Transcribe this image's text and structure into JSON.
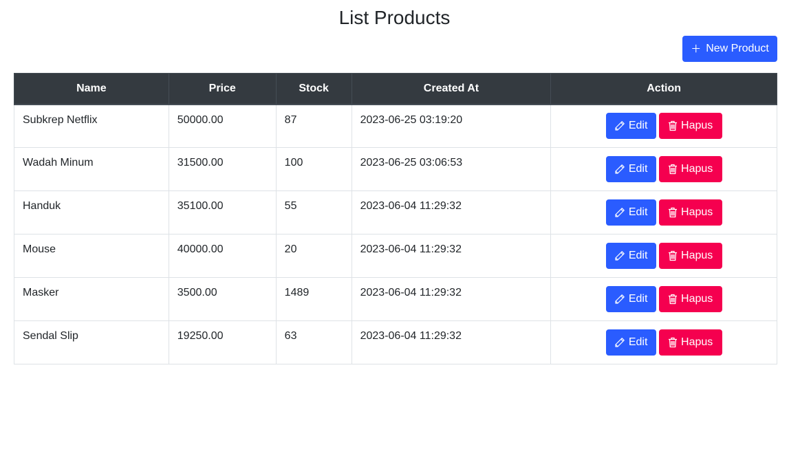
{
  "page": {
    "title": "List Products",
    "new_button_label": "New Product"
  },
  "table": {
    "headers": [
      "Name",
      "Price",
      "Stock",
      "Created At",
      "Action"
    ],
    "rows": [
      {
        "name": "Subkrep Netflix",
        "price": "50000.00",
        "stock": "87",
        "created_at": "2023-06-25 03:19:20"
      },
      {
        "name": "Wadah Minum",
        "price": "31500.00",
        "stock": "100",
        "created_at": "2023-06-25 03:06:53"
      },
      {
        "name": "Handuk",
        "price": "35100.00",
        "stock": "55",
        "created_at": "2023-06-04 11:29:32"
      },
      {
        "name": "Mouse",
        "price": "40000.00",
        "stock": "20",
        "created_at": "2023-06-04 11:29:32"
      },
      {
        "name": "Masker",
        "price": "3500.00",
        "stock": "1489",
        "created_at": "2023-06-04 11:29:32"
      },
      {
        "name": "Sendal Slip",
        "price": "19250.00",
        "stock": "63",
        "created_at": "2023-06-04 11:29:32"
      }
    ],
    "edit_label": "Edit",
    "delete_label": "Hapus"
  },
  "icons": {
    "new": "plus-icon",
    "edit": "pencil-icon",
    "delete": "trash-icon"
  },
  "colors": {
    "primary": "#2a5cff",
    "danger": "#f5004f",
    "header_bg": "#343a40"
  }
}
